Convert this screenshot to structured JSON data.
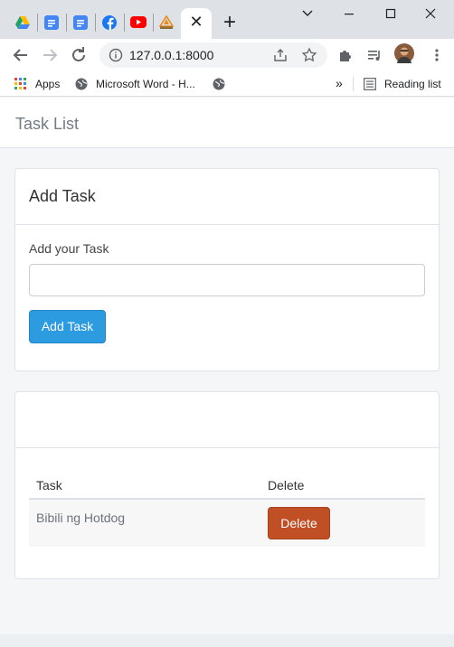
{
  "browser": {
    "tabs": [
      {
        "icon": "google-drive-icon"
      },
      {
        "icon": "google-docs-icon"
      },
      {
        "icon": "google-docs-icon"
      },
      {
        "icon": "facebook-icon"
      },
      {
        "icon": "youtube-icon"
      },
      {
        "icon": "pma-icon"
      }
    ],
    "address": "127.0.0.1:8000",
    "bookmarks": {
      "apps_label": "Apps",
      "item1_label": "Microsoft Word - H...",
      "overflow_label": "»",
      "reading_list_label": "Reading list"
    }
  },
  "navbar": {
    "brand": "Task List"
  },
  "add_panel": {
    "title": "Add Task",
    "input_label": "Add your Task",
    "input_value": "",
    "submit_label": "Add Task"
  },
  "list_panel": {
    "heading": "",
    "columns": [
      "Task",
      "Delete"
    ],
    "rows": [
      {
        "task": "Bibili ng Hotdog",
        "delete_label": "Delete"
      }
    ]
  },
  "colors": {
    "primary": "#2c9be0",
    "danger": "#c14f25",
    "page_background": "#f4f6f8"
  }
}
